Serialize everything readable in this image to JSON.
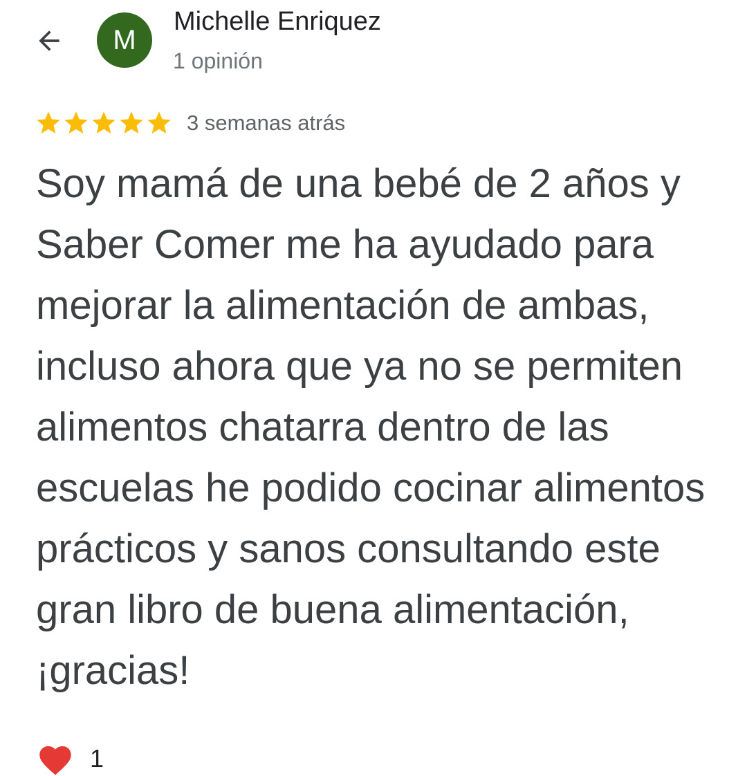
{
  "reviewer": {
    "avatar_initial": "M",
    "avatar_color": "#33691e",
    "name": "Michelle Enriquez",
    "review_count": "1 opinión"
  },
  "review": {
    "rating": 5,
    "max_rating": 5,
    "star_color": "#fbbc04",
    "date": "3 semanas atrás",
    "text": "Soy mamá de una bebé de 2 años y Saber Comer me ha ayudado para mejorar la alimentación de ambas, incluso ahora que ya no se permiten alimentos chatarra dentro de las escuelas he podido cocinar alimentos prácticos y sanos consultando este gran libro de buena alimentación, ¡gracias!"
  },
  "reactions": {
    "icon": "heart-icon",
    "heart_color": "#e53935",
    "count": "1"
  },
  "icons": {
    "back": "arrow-back-icon",
    "star": "star-icon"
  }
}
